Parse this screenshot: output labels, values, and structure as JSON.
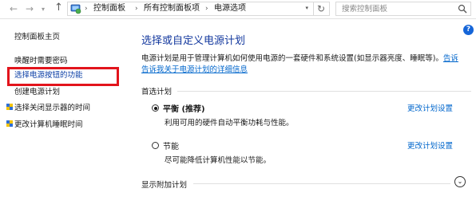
{
  "address_bar": {
    "breadcrumbs": [
      "控制面板",
      "所有控制面板项",
      "电源选项"
    ],
    "search_placeholder": "搜索控制面板"
  },
  "sidebar": {
    "items": [
      {
        "label": "控制面板主页"
      },
      {
        "label": "唤醒时需要密码"
      },
      {
        "label": "选择电源按钮的功能"
      },
      {
        "label": "创建电源计划"
      },
      {
        "label": "选择关闭显示器的时间"
      },
      {
        "label": "更改计算机睡眠时间"
      }
    ]
  },
  "main": {
    "title": "选择或自定义电源计划",
    "description": "电源计划是用于管理计算机如何使用电源的一套硬件和系统设置(如显示器亮度、睡眠等)。",
    "description_link": "告诉我关于电源计划的详细信息",
    "description_link_prefix": "告诉",
    "preferred_heading": "首选计划",
    "plans": [
      {
        "name": "平衡 (推荐)",
        "description": "利用可用的硬件自动平衡功耗与性能。",
        "link": "更改计划设置",
        "selected": true
      },
      {
        "name": "节能",
        "description": "尽可能降低计算机性能以节能。",
        "link": "更改计划设置",
        "selected": false
      }
    ],
    "additional_heading": "显示附加计划"
  },
  "colors": {
    "title": "#13389e",
    "link": "#0066cc",
    "highlight_box": "#e2141c",
    "help_icon": "#1565d8"
  },
  "icons": [
    "back-arrow",
    "forward-arrow",
    "recent-dropdown",
    "up-arrow",
    "control-panel-icon",
    "refresh-icon",
    "search-icon",
    "help-icon",
    "shield-icon",
    "chevron-down-icon"
  ]
}
